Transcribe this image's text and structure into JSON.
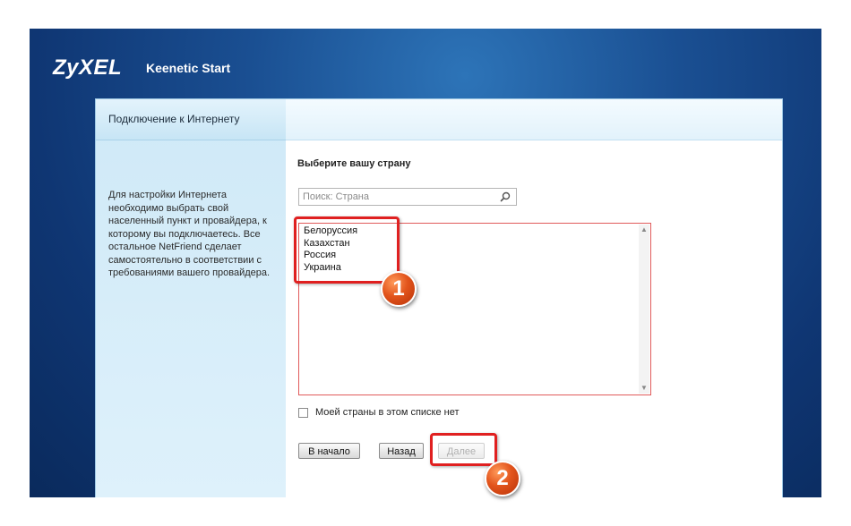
{
  "brand": {
    "logo": "ZyXEL",
    "product": "Keenetic Start"
  },
  "sidebar": {
    "tab_label": "Подключение к Интернету",
    "description": "Для настройки Интернета необходимо выбрать свой населенный пункт и провайдера, к которому вы подключаетесь. Все остальное NetFriend сделает самостоятельно в соответствии с требованиями вашего провайдера."
  },
  "main": {
    "heading": "Выберите вашу страну",
    "search": {
      "placeholder": "Поиск: Страна",
      "value": ""
    },
    "countries": [
      "Белоруссия",
      "Казахстан",
      "Россия",
      "Украина"
    ],
    "checkbox_label": "Моей страны в этом списке нет",
    "checkbox_checked": false
  },
  "buttons": {
    "start": "В начало",
    "back": "Назад",
    "next": "Далее"
  },
  "annotations": {
    "marker_1": "1",
    "marker_2": "2"
  },
  "colors": {
    "highlight": "#e02020",
    "marker": "#e2541c",
    "background": "#1a4f92"
  },
  "icons": {
    "search": "magnifier-icon"
  }
}
